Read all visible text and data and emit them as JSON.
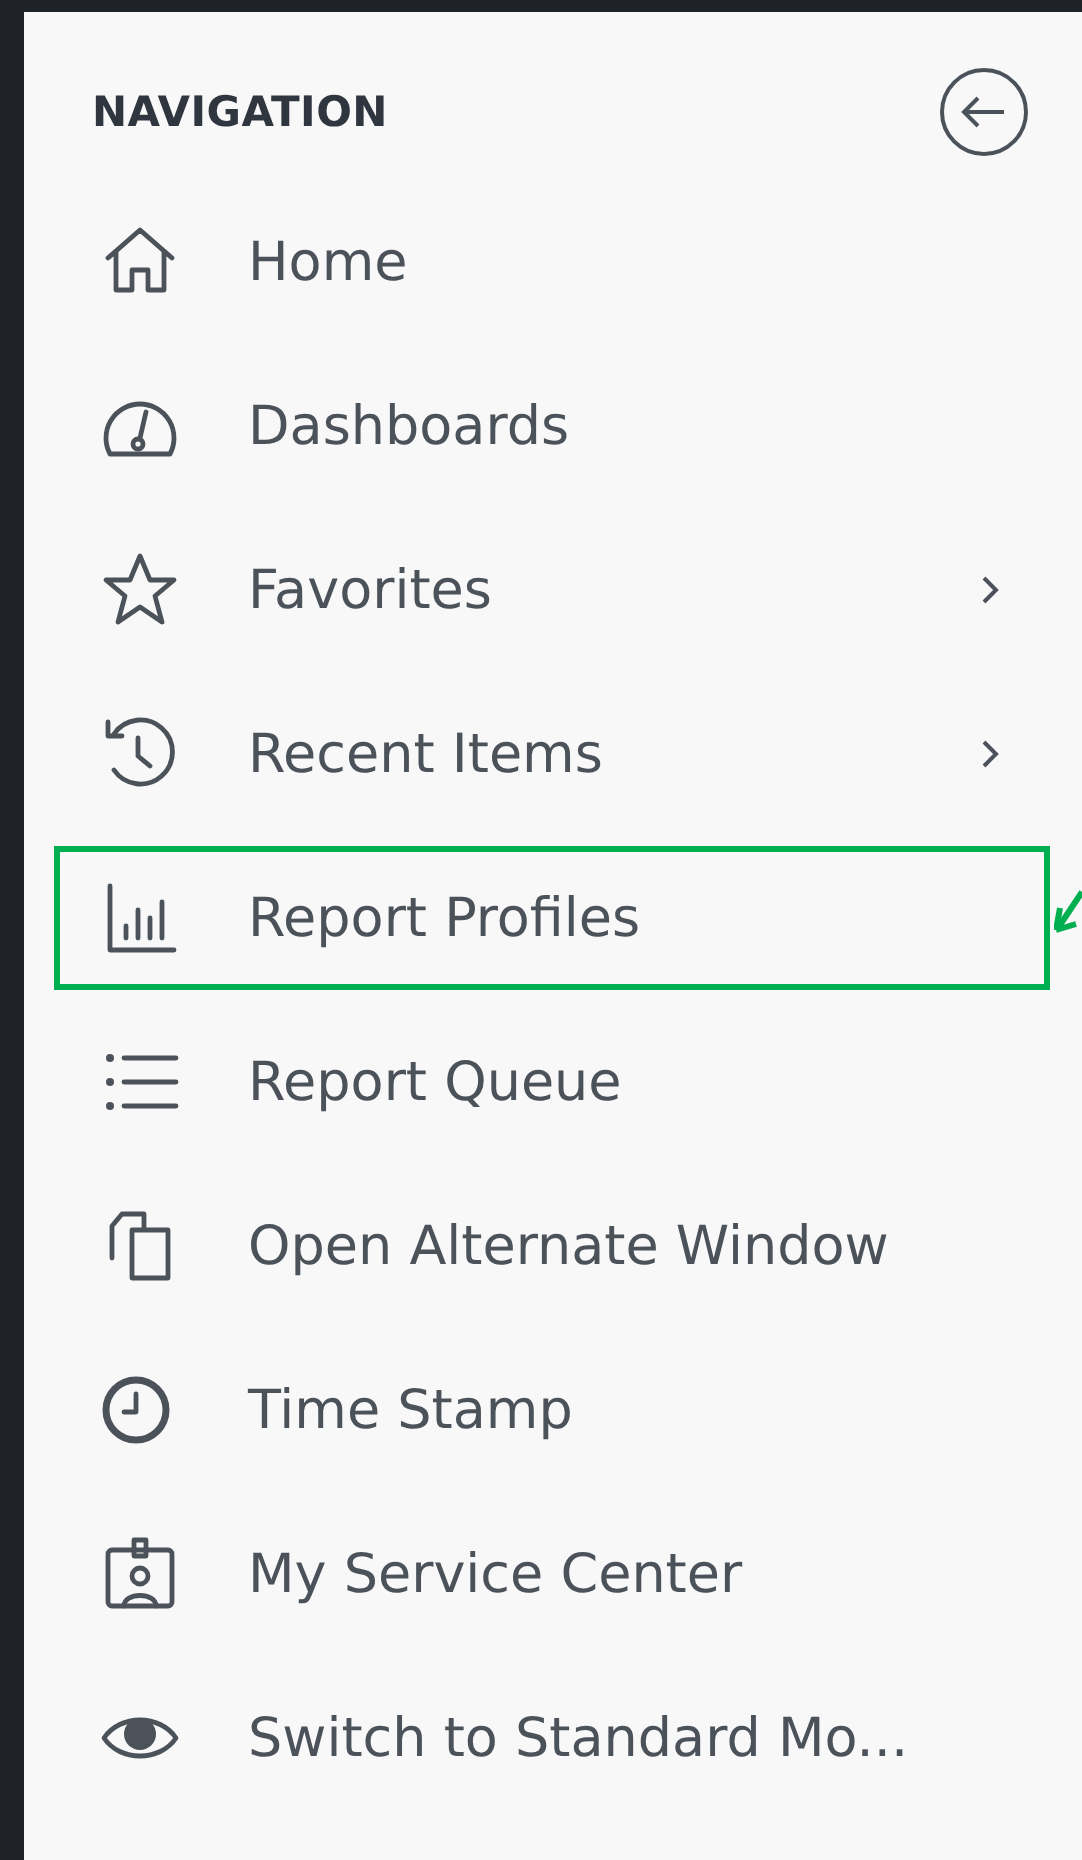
{
  "navigation": {
    "title": "NAVIGATION",
    "items": [
      {
        "label": "Home",
        "has_submenu": false,
        "highlighted": false
      },
      {
        "label": "Dashboards",
        "has_submenu": false,
        "highlighted": false
      },
      {
        "label": "Favorites",
        "has_submenu": true,
        "highlighted": false
      },
      {
        "label": "Recent Items",
        "has_submenu": true,
        "highlighted": false
      },
      {
        "label": "Report Profiles",
        "has_submenu": false,
        "highlighted": true
      },
      {
        "label": "Report Queue",
        "has_submenu": false,
        "highlighted": false
      },
      {
        "label": "Open Alternate Window",
        "has_submenu": false,
        "highlighted": false
      },
      {
        "label": "Time Stamp",
        "has_submenu": false,
        "highlighted": false
      },
      {
        "label": "My Service Center",
        "has_submenu": false,
        "highlighted": false
      },
      {
        "label": "Switch to Standard Mo...",
        "has_submenu": false,
        "highlighted": false
      }
    ]
  }
}
